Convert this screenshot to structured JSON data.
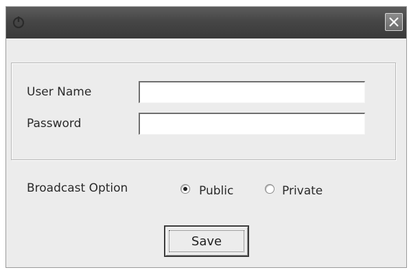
{
  "window": {
    "app_icon": "power-icon",
    "close_icon": "close-icon"
  },
  "form": {
    "user_name_label": "User Name",
    "user_name_value": "",
    "password_label": "Password",
    "password_value": ""
  },
  "broadcast": {
    "label": "Broadcast Option",
    "options": [
      {
        "label": "Public",
        "selected": true
      },
      {
        "label": "Private",
        "selected": false
      }
    ]
  },
  "actions": {
    "save_label": "Save"
  },
  "colors": {
    "titlebar": "#464646",
    "window_bg": "#ececec",
    "border": "#b7b7b7"
  }
}
